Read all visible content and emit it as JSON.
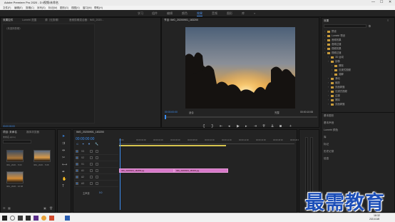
{
  "app": {
    "title": "Adobe Premiere Pro 2020 - D:\\视频\\未命名",
    "window_controls": [
      "—",
      "☐",
      "✕"
    ]
  },
  "menu": [
    "文件(F)",
    "编辑(E)",
    "剪辑(C)",
    "序列(S)",
    "标记(M)",
    "图形(G)",
    "视图(V)",
    "窗口(W)",
    "帮助(H)"
  ],
  "workspaces": {
    "items": [
      "学习",
      "组件",
      "编辑",
      "颜色",
      "效果",
      "音频",
      "图形",
      "库"
    ],
    "active": "效果",
    "more": "»"
  },
  "effect_controls": {
    "tabs": [
      "效果控件",
      "Lumetri 范围",
      "源（无剪辑）",
      "音频剪辑混合器：IMG_2020..."
    ],
    "sub_label": "（未选择剪辑）",
    "timecode": "00:00:00:00"
  },
  "program": {
    "tab": "节目: IMG_20200901_183200",
    "timecode": "00:00:00:00",
    "fit": "适合",
    "quality": "完整",
    "duration": "00:00:10:08"
  },
  "effects_panel": {
    "title": "效果",
    "items": [
      {
        "label": "预设",
        "indent": 0
      },
      {
        "label": "Lumetri 预设",
        "indent": 0
      },
      {
        "label": "音频效果",
        "indent": 0
      },
      {
        "label": "音频过渡",
        "indent": 0
      },
      {
        "label": "视频效果",
        "indent": 0
      },
      {
        "label": "视频过渡",
        "indent": 0
      },
      {
        "label": "3D 运动",
        "indent": 1
      },
      {
        "label": "划像",
        "indent": 1
      },
      {
        "label": "擦除",
        "indent": 2
      },
      {
        "label": "沉浸式视频",
        "indent": 2
      },
      {
        "label": "溶解",
        "indent": 2
      },
      {
        "label": "滑动",
        "indent": 1
      },
      {
        "label": "缩放",
        "indent": 1
      },
      {
        "label": "页面剥落",
        "indent": 1
      },
      {
        "label": "沉浸式视频",
        "indent": 1
      },
      {
        "label": "过渡",
        "indent": 1
      },
      {
        "label": "擦除",
        "indent": 1
      },
      {
        "label": "页面剥落",
        "indent": 1
      }
    ],
    "sections": [
      "基本图形",
      "基本声音",
      "Lumetri 颜色",
      "库",
      "标记",
      "历史记录",
      "信息"
    ]
  },
  "project": {
    "tabs": [
      "项目: 未命名",
      "媒体浏览器"
    ],
    "file": "未命名.prproj",
    "clips": [
      {
        "name": "IMG_2020...",
        "duration": "5:00"
      },
      {
        "name": "IMG_2020...",
        "duration": "5:08"
      },
      {
        "name": "IMG_2020...",
        "duration": "10:08"
      }
    ]
  },
  "timeline": {
    "tab": "IMG_20200901_183200",
    "timecode": "00:00:00:00",
    "ruler": [
      "00:00",
      "00:00:02:00",
      "00:00:04:00",
      "00:00:06:00",
      "00:00:08:00",
      "00:00:10:00",
      "00:00:12:00",
      "00:00:14:00",
      "00:00:16:00",
      "00:00:18:00",
      "00:00:20:00"
    ],
    "tracks": [
      {
        "id": "V3",
        "kind": "video"
      },
      {
        "id": "V2",
        "kind": "video"
      },
      {
        "id": "V1",
        "kind": "video"
      },
      {
        "id": "A1",
        "kind": "audio"
      },
      {
        "id": "A2",
        "kind": "audio"
      },
      {
        "id": "A3",
        "kind": "audio"
      }
    ],
    "master": "主声道",
    "master_value": "0.0",
    "clips": [
      {
        "name": "IMG_20200901_182658.jpg",
        "start": 0,
        "end": 5
      },
      {
        "name": "IMG_20200901_183200.jpg",
        "start": 5,
        "end": 10.08
      }
    ]
  },
  "taskbar": {
    "time": "18:32",
    "date": "2021/10/8"
  },
  "watermark": "最需教育"
}
